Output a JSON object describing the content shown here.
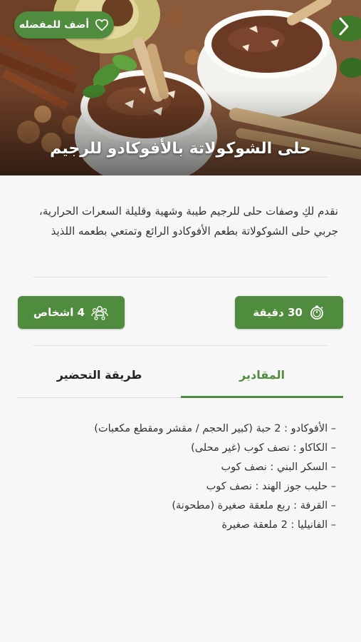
{
  "hero": {
    "title": "حلى الشوكولاتة بالأفوكادو للرجيم",
    "favorite_label": "أضف للمفضله",
    "favorite_icon": "heart-outline-icon",
    "next_icon": "chevron-right-icon"
  },
  "description": "نقدم لكِ وصفات حلى للرجيم طيبة وشهية وقليلة السعرات الحرارية، جربي حلى الشوكولاتة بطعم الأفوكادو الرائع وتمتعي بطعمه اللذيذ",
  "info": {
    "time_label": "30 دقيقة",
    "time_icon": "stopwatch-icon",
    "servings_label": "4 اشخاص",
    "servings_icon": "people-group-icon"
  },
  "tabs": {
    "ingredients": "المقادير",
    "method": "طريقة التحضير",
    "active": "ingredients"
  },
  "ingredients": [
    "– الأفوكادو : 2 حبة (كبير الحجم / مقشر ومقطع مكعبات)",
    "– الكاكاو : نصف كوب (غير محلى)",
    "– السكر البني : نصف كوب",
    "– حليب جوز الهند : نصف كوب",
    "– القرفة : ربع ملعقة صغيرة (مطحونة)",
    "– الفانيليا : 2 ملعقة صغيرة"
  ],
  "colors": {
    "accent": "#4f8c3d",
    "background": "#f7f7f7",
    "text": "#333333"
  }
}
